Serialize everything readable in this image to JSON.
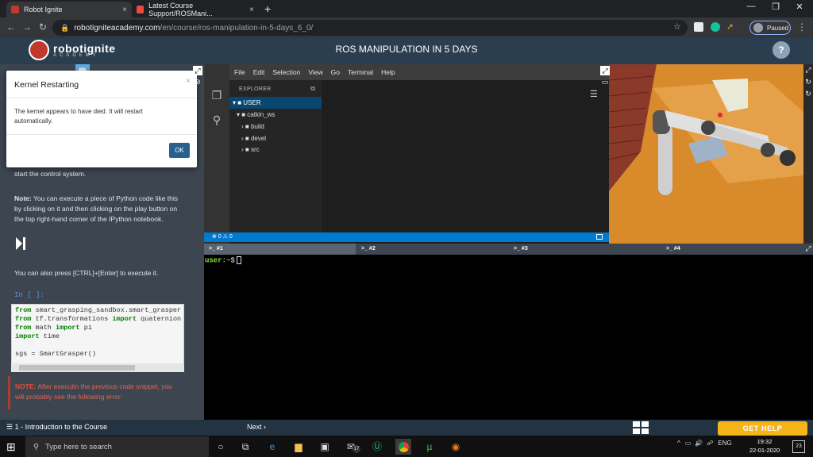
{
  "browser": {
    "tabs": [
      {
        "label": "Robot Ignite",
        "close": "×"
      },
      {
        "label": "Latest Course Support/ROSMani...",
        "close": "×"
      }
    ],
    "new_tab": "+",
    "url_host": "robotigniteacademy.com",
    "url_path": "/en/course/ros-manipulation-in-5-days_6_0/",
    "profile_status": "Paused",
    "window_controls": {
      "minimize": "—",
      "restore": "❐",
      "close": "✕"
    },
    "nav": {
      "back": "←",
      "forward": "→",
      "reload": "↻",
      "lock": "🔒"
    }
  },
  "header": {
    "brand": "robotignite",
    "brand_sub": "ACADEMY",
    "course_title": "ROS MANIPULATION IN 5 DAYS",
    "help": "?"
  },
  "notebook": {
    "line_start": "start the control system.",
    "note1_label": "Note:",
    "note1_text": " You can execute a piece of Python code like this by clicking on it and then clicking on the play button on the top right-hand corner of the IPython notebook.",
    "shortcut_text": "You can also press [CTRL]+[Enter] to execute it.",
    "prompt": "In [ ]:",
    "code_lines": [
      {
        "kw": "from",
        "rest": " smart_grasping_sandbox.smart_grasper"
      },
      {
        "kw": "from",
        "rest": " tf.transformations ",
        "kw2": "import",
        "rest2": " quaternion"
      },
      {
        "kw": "from",
        "rest": " math ",
        "kw2": "import",
        "rest2": " pi"
      },
      {
        "kw": "import",
        "rest": " time"
      },
      {
        "kw": "",
        "rest": ""
      },
      {
        "kw": "",
        "rest": "sgs = SmartGrasper()"
      }
    ],
    "note2_label": "NOTE:",
    "note2_text": " After executin the previous code snippet, you will probably see the following error:"
  },
  "modal": {
    "title": "Kernel Restarting",
    "body": "The kernel appears to have died. It will restart automatically.",
    "ok": "OK",
    "close": "×"
  },
  "ide": {
    "menu": [
      "File",
      "Edit",
      "Selection",
      "View",
      "Go",
      "Terminal",
      "Help"
    ],
    "explorer_header": "EXPLORER",
    "tree": {
      "root": "USER",
      "ws": "catkin_ws",
      "children": [
        "build",
        "devel",
        "src"
      ]
    },
    "status": "⊗ 0 ⚠ 0"
  },
  "terminal": {
    "tabs": [
      ">_ #1",
      ">_ #2",
      ">_ #3",
      ">_ #4"
    ],
    "prompt_user": "user:",
    "prompt_rest": "~$"
  },
  "bottom": {
    "course": "☰ 1 - Introduction to the Course",
    "next": "Next ›",
    "get_help": "GET HELP"
  },
  "taskbar": {
    "search_placeholder": "Type here to search",
    "tray_lang": "ENG",
    "time": "19:32",
    "date": "22-01-2020",
    "notif_count": "23",
    "mail_badge": "17"
  }
}
